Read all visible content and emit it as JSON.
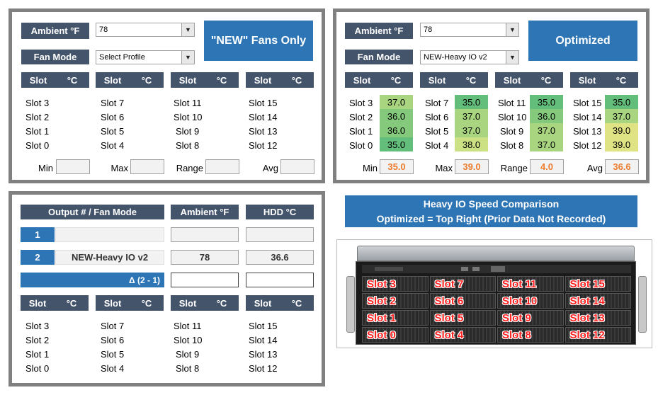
{
  "left_panel": {
    "ambient_label": "Ambient °F",
    "ambient_value": "78",
    "fan_mode_label": "Fan Mode",
    "fan_mode_value": "Select Profile",
    "profile_button": "\"NEW\" Fans Only",
    "col_slot": "Slot",
    "col_temp": "°C",
    "groups": [
      [
        "Slot 3",
        "Slot 2",
        "Slot 1",
        "Slot 0"
      ],
      [
        "Slot 7",
        "Slot 6",
        "Slot 5",
        "Slot 4"
      ],
      [
        "Slot 11",
        "Slot 10",
        "Slot 9",
        "Slot 8"
      ],
      [
        "Slot 15",
        "Slot 14",
        "Slot 13",
        "Slot 12"
      ]
    ],
    "min_label": "Min",
    "max_label": "Max",
    "range_label": "Range",
    "avg_label": "Avg"
  },
  "right_panel": {
    "ambient_label": "Ambient °F",
    "ambient_value": "78",
    "fan_mode_label": "Fan Mode",
    "fan_mode_value": "NEW-Heavy IO v2",
    "profile_button": "Optimized",
    "col_slot": "Slot",
    "col_temp": "°C",
    "groups": [
      {
        "slots": [
          "Slot 3",
          "Slot 2",
          "Slot 1",
          "Slot 0"
        ],
        "temps": [
          "37.0",
          "36.0",
          "36.0",
          "35.0"
        ]
      },
      {
        "slots": [
          "Slot 7",
          "Slot 6",
          "Slot 5",
          "Slot 4"
        ],
        "temps": [
          "35.0",
          "37.0",
          "37.0",
          "38.0"
        ]
      },
      {
        "slots": [
          "Slot 11",
          "Slot 10",
          "Slot 9",
          "Slot 8"
        ],
        "temps": [
          "35.0",
          "36.0",
          "37.0",
          "37.0"
        ]
      },
      {
        "slots": [
          "Slot 15",
          "Slot 14",
          "Slot 13",
          "Slot 12"
        ],
        "temps": [
          "35.0",
          "37.0",
          "39.0",
          "39.0"
        ]
      }
    ],
    "min_label": "Min",
    "min_value": "35.0",
    "max_label": "Max",
    "max_value": "39.0",
    "range_label": "Range",
    "range_value": "4.0",
    "avg_label": "Avg",
    "avg_value": "36.6"
  },
  "bottom_panel": {
    "col_output": "Output # / Fan Mode",
    "col_ambient": "Ambient °F",
    "col_hdd": "HDD °C",
    "row1_num": "1",
    "row1_mode": "",
    "row2_num": "2",
    "row2_mode": "NEW-Heavy IO v2",
    "row2_ambient": "78",
    "row2_hdd": "36.6",
    "delta_label": "Δ (2 - 1)",
    "col_slot": "Slot",
    "col_temp": "°C",
    "groups": [
      [
        "Slot 3",
        "Slot 2",
        "Slot 1",
        "Slot 0"
      ],
      [
        "Slot 7",
        "Slot 6",
        "Slot 5",
        "Slot 4"
      ],
      [
        "Slot 11",
        "Slot 10",
        "Slot 9",
        "Slot 8"
      ],
      [
        "Slot 15",
        "Slot 14",
        "Slot 13",
        "Slot 12"
      ]
    ]
  },
  "comparison_banner": {
    "line1": "Heavy IO Speed Comparison",
    "line2": "Optimized = Top Right (Prior Data Not Recorded)"
  },
  "server_image": {
    "bay_labels": [
      [
        "Slot 3",
        "Slot 7",
        "Slot 11",
        "Slot 15"
      ],
      [
        "Slot 2",
        "Slot 6",
        "Slot 10",
        "Slot 14"
      ],
      [
        "Slot 1",
        "Slot 5",
        "Slot 9",
        "Slot 13"
      ],
      [
        "Slot 0",
        "Slot 4",
        "Slot 8",
        "Slot 12"
      ]
    ]
  },
  "colors": {
    "header_navy": "#44546a",
    "accent_blue": "#2e75b6",
    "value_orange": "#ed7d31",
    "panel_border": "#808080",
    "heat_35": "#63be7b",
    "heat_36": "#85c97d",
    "heat_37": "#a9d580",
    "heat_38": "#cce183",
    "heat_39": "#e0e383",
    "bay_label_red": "#ff2020"
  }
}
